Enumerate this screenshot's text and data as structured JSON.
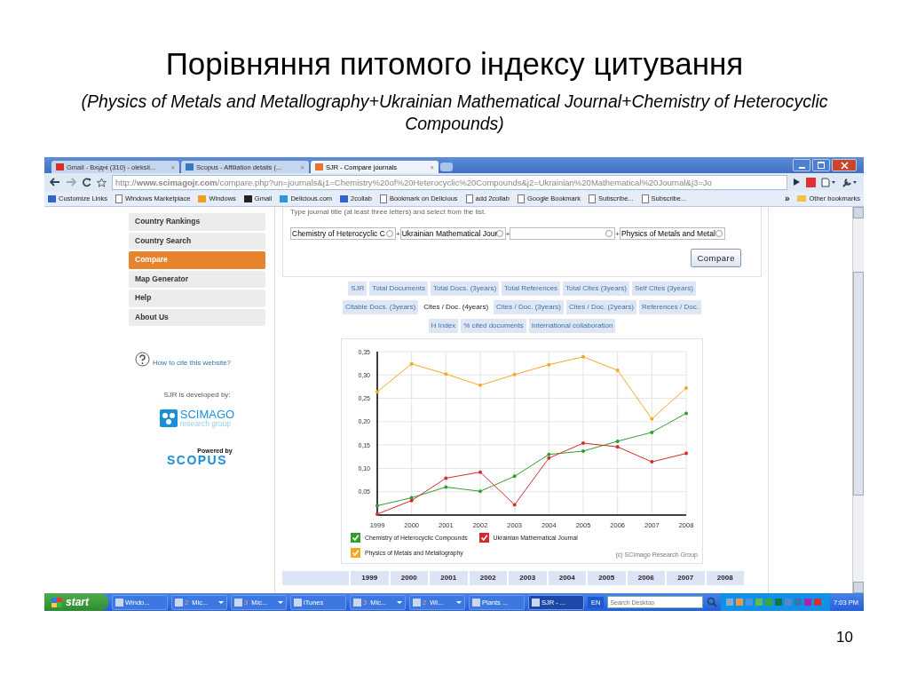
{
  "slide": {
    "title": "Порівняння питомого індексу цитування",
    "subtitle": "(Physics of Metals and Metallography+Ukrainian Mathematical Journal+Chemistry of Heterocyclic Compounds)",
    "page_number": "10"
  },
  "browser": {
    "tabs": [
      {
        "label": "Gmail - Вхідні (310) - oleksii...",
        "kind": "mail",
        "close": "×",
        "selected": false
      },
      {
        "label": "Scopus - Affiliation details (...",
        "kind": "scopus",
        "close": "×",
        "selected": false
      },
      {
        "label": "SJR - Compare journals",
        "kind": "sjr",
        "close": "×",
        "selected": true
      }
    ],
    "address": "http://**www.scimagojr.com**/compare.php?un=journals&j1=Chemistry%20of%20Heterocyclic%20Compounds&j2=Ukrainian%20Mathematical%20Journal&j3=Jo",
    "bookmarks": [
      {
        "label": "Customize Links",
        "kind": "brand"
      },
      {
        "label": "Windows Marketplace",
        "kind": "page"
      },
      {
        "label": "Windows",
        "kind": "brand"
      },
      {
        "label": "Gmail",
        "kind": "brand"
      },
      {
        "label": "Delicious.com",
        "kind": "brand"
      },
      {
        "label": "2collab",
        "kind": "brand"
      },
      {
        "label": "Bookmark on Delicious",
        "kind": "page"
      },
      {
        "label": "add 2collab",
        "kind": "page"
      },
      {
        "label": "Google Bookmark",
        "kind": "page"
      },
      {
        "label": "Subscribe...",
        "kind": "page"
      },
      {
        "label": "Subscribe...",
        "kind": "page"
      }
    ],
    "more": "»",
    "other_bookmarks": "Other bookmarks"
  },
  "sidebar": {
    "items": [
      {
        "label": "Country Rankings",
        "selected": false
      },
      {
        "label": "Country Search",
        "selected": false
      },
      {
        "label": "Compare",
        "selected": true
      },
      {
        "label": "Map Generator",
        "selected": false
      },
      {
        "label": "Help",
        "selected": false
      },
      {
        "label": "About Us",
        "selected": false
      }
    ],
    "cite_link": "How to cite this website?",
    "developed_by": "SJR is developed by:",
    "scimago": {
      "name": "SCIMAGO",
      "tagline": "research group"
    },
    "scopus": {
      "powered_by": "Powered by",
      "name": "SCOPUS"
    }
  },
  "compare_form": {
    "hint": "Type journal title (at least three letters) and select from the list.",
    "fields": [
      {
        "value": "Chemistry of Heterocyclic C",
        "joiner": "+"
      },
      {
        "value": "Ukrainian Mathematical Jour",
        "joiner": "+"
      },
      {
        "joiner": "+"
      },
      {
        "value": "Physics of Metals and Metal"
      }
    ],
    "button": "Compare"
  },
  "metrics": [
    [
      {
        "label": "SJR",
        "selected": false
      },
      {
        "label": "Total Documents",
        "selected": false
      },
      {
        "label": "Total Docs. (3years)",
        "selected": false
      },
      {
        "label": "Total References",
        "selected": false
      },
      {
        "label": "Total Cites (3years)",
        "selected": false
      },
      {
        "label": "Self Cites (3years)",
        "selected": false
      }
    ],
    [
      {
        "label": "Citable Docs. (3years)",
        "selected": false
      },
      {
        "label": "Cites / Doc. (4years)",
        "selected": true
      },
      {
        "label": "Cites / Doc. (3years)",
        "selected": false
      },
      {
        "label": "Cites / Doc. (2years)",
        "selected": false
      },
      {
        "label": "References / Doc.",
        "selected": false
      }
    ],
    [
      {
        "label": "H Index",
        "selected": false
      },
      {
        "label": "% cited documents",
        "selected": false
      },
      {
        "label": "International collaboration",
        "selected": false
      }
    ]
  ],
  "chart": {
    "chart_data": {
      "type": "line",
      "categories": [
        "1999",
        "2000",
        "2001",
        "2002",
        "2003",
        "2004",
        "2005",
        "2006",
        "2007",
        "2008"
      ],
      "series": [
        {
          "name": "Chemistry of Heterocyclic Compounds",
          "color": "#2e9e2e",
          "values": [
            0.02,
            0.037,
            0.06,
            0.051,
            0.083,
            0.13,
            0.137,
            0.158,
            0.177,
            0.218
          ]
        },
        {
          "name": "Ukrainian Mathematical Journal",
          "color": "#d42a2a",
          "values": [
            0.002,
            0.031,
            0.079,
            0.092,
            0.022,
            0.122,
            0.154,
            0.146,
            0.114,
            0.132
          ]
        },
        {
          "name": "Physics of Metals and Metallography",
          "color": "#f5a623",
          "values": [
            0.264,
            0.324,
            0.302,
            0.278,
            0.301,
            0.322,
            0.339,
            0.31,
            0.206,
            0.272
          ]
        }
      ],
      "ylim": [
        0,
        0.35
      ],
      "grid": true,
      "legend": "bottom",
      "yticks": [
        {
          "value": 0.05,
          "label": "0,05"
        },
        {
          "value": 0.1,
          "label": "0,10"
        },
        {
          "value": 0.15,
          "label": "0,15"
        },
        {
          "value": 0.2,
          "label": "0,20"
        },
        {
          "value": 0.25,
          "label": "0,25"
        },
        {
          "value": 0.3,
          "label": "0,30"
        },
        {
          "value": 0.35,
          "label": "0,35"
        }
      ]
    },
    "credit": "(c) SCImago Research Group"
  },
  "table": {
    "columns": [
      "1999",
      "2000",
      "2001",
      "2002",
      "2003",
      "2004",
      "2005",
      "2006",
      "2007",
      "2008"
    ]
  },
  "taskbar": {
    "start": "start",
    "items": [
      {
        "label": "Windo...",
        "selected": false
      },
      {
        "count": "2",
        "label": "Mic...",
        "grouped": true,
        "selected": false
      },
      {
        "count": "3",
        "label": "Mic...",
        "grouped": true,
        "selected": false
      },
      {
        "label": "iTunes",
        "selected": false
      },
      {
        "count": "3",
        "label": "Mic...",
        "grouped": true,
        "selected": false
      },
      {
        "count": "2",
        "label": "Wi...",
        "grouped": true,
        "selected": false
      },
      {
        "label": "Plants ...",
        "selected": false
      },
      {
        "label": "SJR - ...",
        "selected": true
      }
    ],
    "language": "EN",
    "search_placeholder": "Search Desktop",
    "clock": "7:03 PM"
  }
}
